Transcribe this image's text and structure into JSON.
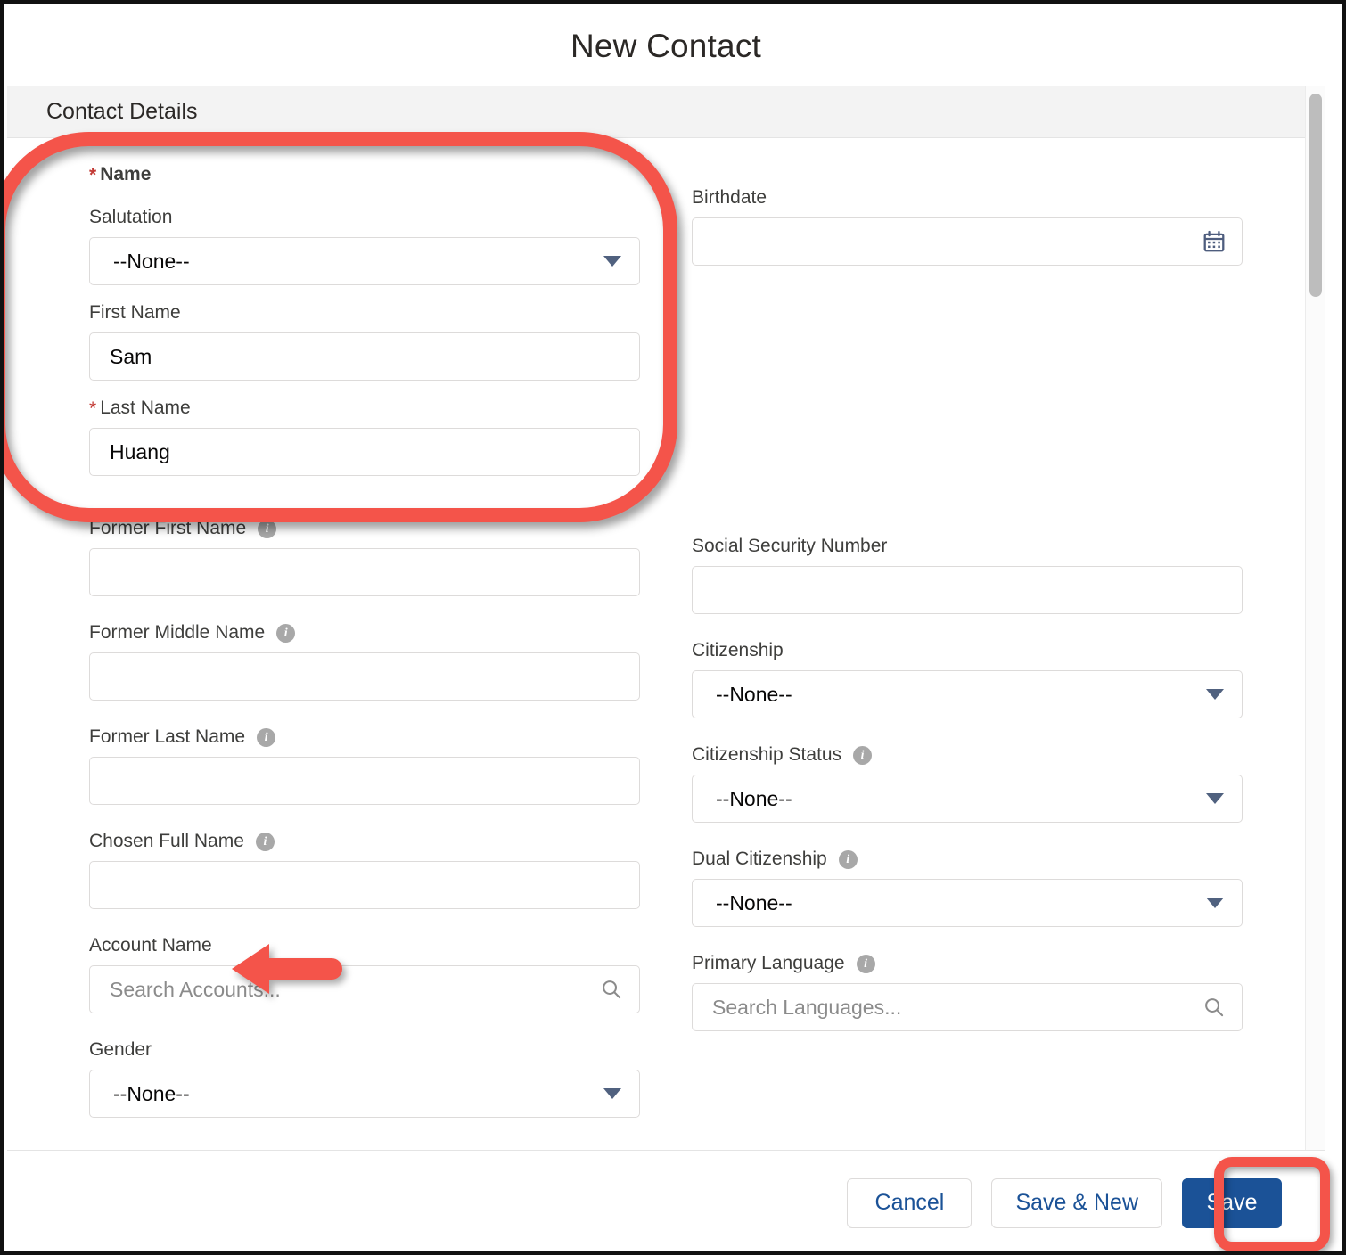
{
  "modal": {
    "title": "New Contact",
    "section_title": "Contact Details"
  },
  "colors": {
    "accent_blue": "#1b5297",
    "annotation_red": "#f4544a",
    "required_red": "#c23934",
    "caret_blue": "#50617f",
    "info_gray": "#a8a8a8"
  },
  "form": {
    "name_group_label": "Name",
    "left": [
      {
        "label": "Salutation",
        "type": "select",
        "value": "--None--",
        "required": false,
        "info": false
      },
      {
        "label": "First Name",
        "type": "text",
        "value": "Sam",
        "placeholder": "",
        "required": false,
        "info": false
      },
      {
        "label": "Last Name",
        "type": "text",
        "value": "Huang",
        "placeholder": "",
        "required": true,
        "info": false
      },
      {
        "label": "Former First Name",
        "type": "text",
        "value": "",
        "placeholder": "",
        "required": false,
        "info": true
      },
      {
        "label": "Former Middle Name",
        "type": "text",
        "value": "",
        "placeholder": "",
        "required": false,
        "info": true
      },
      {
        "label": "Former Last Name",
        "type": "text",
        "value": "",
        "placeholder": "",
        "required": false,
        "info": true
      },
      {
        "label": "Chosen Full Name",
        "type": "text",
        "value": "",
        "placeholder": "",
        "required": false,
        "info": true
      },
      {
        "label": "Account Name",
        "type": "lookup",
        "value": "",
        "placeholder": "Search Accounts...",
        "required": false,
        "info": false
      },
      {
        "label": "Gender",
        "type": "select",
        "value": "--None--",
        "required": false,
        "info": false
      }
    ],
    "right": [
      {
        "label": "Birthdate",
        "type": "date",
        "value": "",
        "placeholder": "",
        "required": false,
        "info": false
      },
      {
        "label": "Social Security Number",
        "type": "text",
        "value": "",
        "placeholder": "",
        "required": false,
        "info": false
      },
      {
        "label": "Citizenship",
        "type": "select",
        "value": "--None--",
        "required": false,
        "info": false
      },
      {
        "label": "Citizenship Status",
        "type": "select",
        "value": "--None--",
        "required": false,
        "info": true
      },
      {
        "label": "Dual Citizenship",
        "type": "select",
        "value": "--None--",
        "required": false,
        "info": true
      },
      {
        "label": "Primary Language",
        "type": "lookup",
        "value": "",
        "placeholder": "Search Languages...",
        "required": false,
        "info": true
      }
    ]
  },
  "footer": {
    "cancel_label": "Cancel",
    "save_new_label": "Save & New",
    "save_label": "Save"
  },
  "icons": {
    "calendar": "calendar-icon",
    "search": "search-icon",
    "info": "info-icon",
    "caret": "chevron-down-icon"
  },
  "annotations": [
    {
      "kind": "rounded-rect-highlight",
      "target": "name-field-group"
    },
    {
      "kind": "left-arrow",
      "target": "account-name-label"
    },
    {
      "kind": "rounded-rect-highlight",
      "target": "save-button"
    }
  ]
}
